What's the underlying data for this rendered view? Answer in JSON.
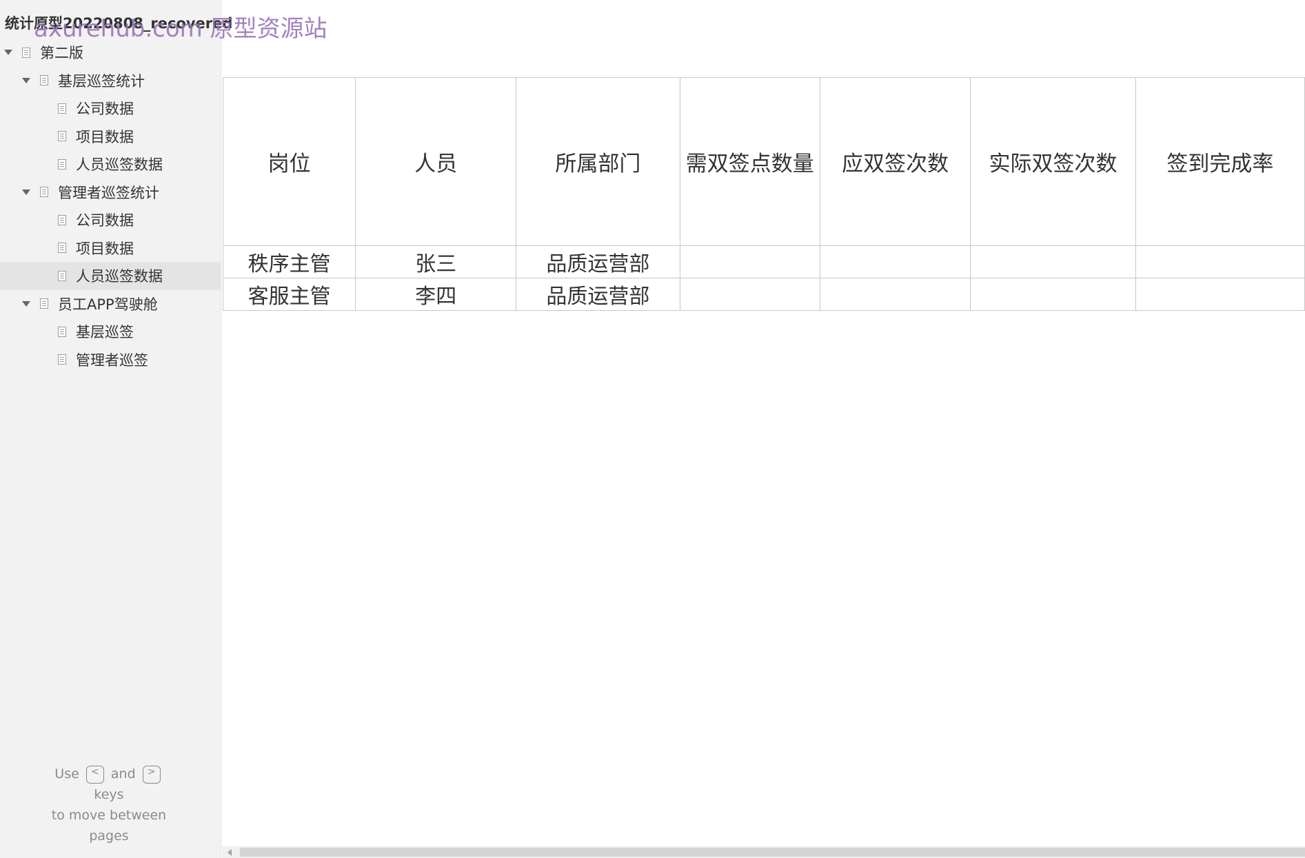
{
  "sidebar": {
    "project_title": "统计原型20220808_recovered",
    "watermark": "axurehub.com 原型资源站",
    "tree": [
      {
        "label": "第二版",
        "level": 0,
        "expanded": true,
        "selected": false
      },
      {
        "label": "基层巡签统计",
        "level": 1,
        "expanded": true,
        "selected": false
      },
      {
        "label": "公司数据",
        "level": 2,
        "selected": false
      },
      {
        "label": "项目数据",
        "level": 2,
        "selected": false
      },
      {
        "label": "人员巡签数据",
        "level": 2,
        "selected": false
      },
      {
        "label": "管理者巡签统计",
        "level": 1,
        "expanded": true,
        "selected": false
      },
      {
        "label": "公司数据",
        "level": 2,
        "selected": false
      },
      {
        "label": "项目数据",
        "level": 2,
        "selected": false
      },
      {
        "label": "人员巡签数据",
        "level": 2,
        "selected": true
      },
      {
        "label": "员工APP驾驶舱",
        "level": 1,
        "expanded": true,
        "selected": false
      },
      {
        "label": "基层巡签",
        "level": 2,
        "selected": false
      },
      {
        "label": "管理者巡签",
        "level": 2,
        "selected": false
      }
    ],
    "keys_hint": {
      "use": "Use",
      "and": "and",
      "keys": "keys",
      "line2": "to move between",
      "line3": "pages",
      "prev_key": "<",
      "next_key": ">"
    }
  },
  "table": {
    "columns": [
      "岗位",
      "人员",
      "所属部门",
      "需双签点数量",
      "应双签次数",
      "实际双签次数",
      "签到完成率"
    ],
    "rows": [
      [
        "秩序主管",
        "张三",
        "品质运营部",
        "",
        "",
        "",
        ""
      ],
      [
        "客服主管",
        "李四",
        "品质运营部",
        "",
        "",
        "",
        ""
      ]
    ]
  },
  "colors": {
    "sidebar_bg": "#f2f2f2",
    "selected_bg": "#e4e4e4",
    "table_border": "#c7c7c7",
    "watermark": "#9a74b8"
  }
}
